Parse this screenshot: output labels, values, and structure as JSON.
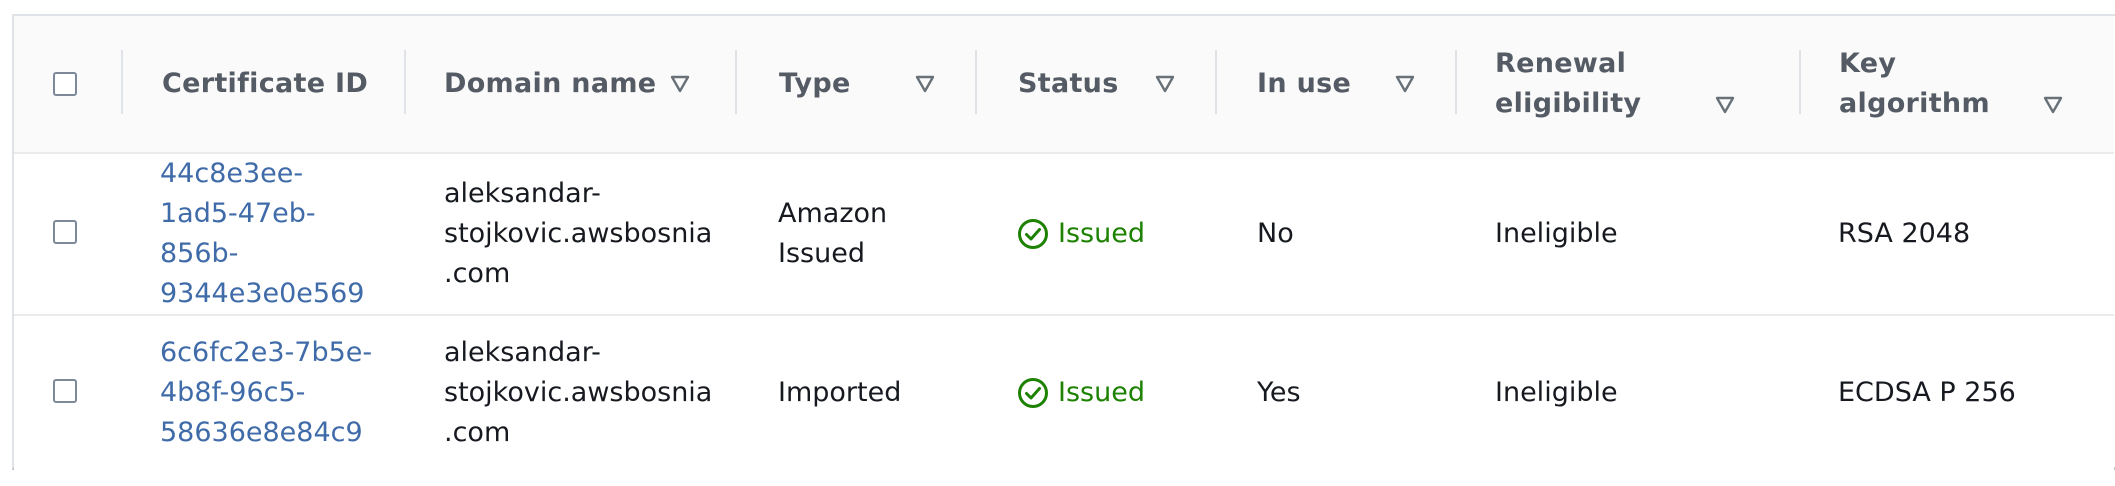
{
  "table": {
    "columns": [
      {
        "label": "Certificate ID",
        "sortable": false
      },
      {
        "label": "Domain name",
        "sortable": true
      },
      {
        "label": "Type",
        "sortable": true
      },
      {
        "label": "Status",
        "sortable": true
      },
      {
        "label": "In use",
        "sortable": true
      },
      {
        "label": "Renewal eligibility",
        "label_lines": [
          "Renewal",
          "eligibility"
        ],
        "sortable": true
      },
      {
        "label": "Key algorithm",
        "label_lines": [
          "Key",
          "algorithm"
        ],
        "sortable": true
      }
    ],
    "rows": [
      {
        "certificate_id": "44c8e3ee-1ad5-47eb-856b-9344e3e0e569",
        "certificate_id_lines": [
          "44c8e3ee-",
          "1ad5-47eb-",
          "856b-",
          "9344e3e0e569"
        ],
        "domain_name": "aleksandar-stojkovic.awsbosnia.com",
        "domain_name_lines": [
          "aleksandar-",
          "stojkovic.awsbosnia",
          ".com"
        ],
        "type": "Amazon Issued",
        "type_lines": [
          "Amazon",
          "Issued"
        ],
        "status": "Issued",
        "in_use": "No",
        "renewal_eligibility": "Ineligible",
        "key_algorithm": "RSA 2048"
      },
      {
        "certificate_id": "6c6fc2e3-7b5e-4b8f-96c5-58636e8e84c9",
        "certificate_id_lines": [
          "6c6fc2e3-7b5e-",
          "4b8f-96c5-",
          "58636e8e84c9"
        ],
        "domain_name": "aleksandar-stojkovic.awsbosnia.com",
        "domain_name_lines": [
          "aleksandar-",
          "stojkovic.awsbosnia",
          ".com"
        ],
        "type": "Imported",
        "status": "Issued",
        "in_use": "Yes",
        "renewal_eligibility": "Ineligible",
        "key_algorithm": "ECDSA P 256"
      }
    ]
  },
  "colors": {
    "link": "#3f6ba9",
    "status_success": "#1d8102",
    "header_text": "#545b64",
    "header_bg": "#fafafa"
  },
  "icons": {
    "sort": "caret-down-outline-icon",
    "status": "check-circle-icon"
  }
}
